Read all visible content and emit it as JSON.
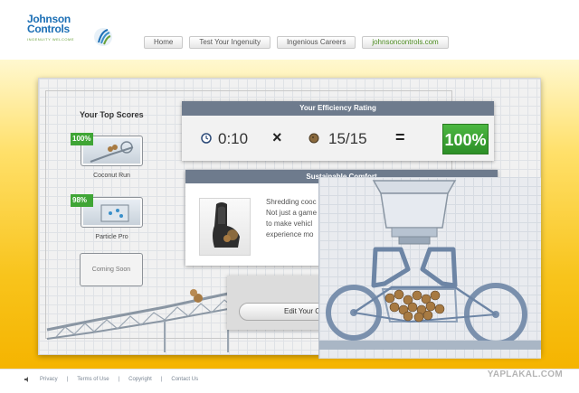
{
  "brand": {
    "name_line1": "Johnson",
    "name_line2": "Controls",
    "tagline": "INGENUITY WELCOME"
  },
  "nav": [
    {
      "label": "Home"
    },
    {
      "label": "Test Your Ingenuity"
    },
    {
      "label": "Ingenious Careers"
    },
    {
      "label": "johnsoncontrols.com"
    }
  ],
  "scores": {
    "title": "Your Top Scores",
    "games": [
      {
        "name": "Coconut Run",
        "score": "100%"
      },
      {
        "name": "Particle Pro",
        "score": "98%"
      }
    ],
    "coming_soon": "Coming Soon"
  },
  "efficiency": {
    "title": "Your Efficiency Rating",
    "time": "0:10",
    "times_symbol": "×",
    "collected": "15/15",
    "equals_symbol": "=",
    "result": "100%",
    "icons": [
      "clock-icon",
      "coconut-icon"
    ]
  },
  "comfort": {
    "title": "Sustainable Comfort",
    "text_lines": [
      "Shredding cooc",
      "Not just a game",
      "to make vehicl",
      "experience mo"
    ]
  },
  "edit_button": "Edit Your C",
  "footer": {
    "links": [
      "Privacy",
      "Terms of Use",
      "Copyright",
      "Contact Us"
    ],
    "icons": [
      "speaker-icon"
    ]
  },
  "watermark": "YAPLAKAL.COM",
  "colors": {
    "accent_green": "#3fa535",
    "brand_blue": "#1c6fb5",
    "panel_header": "#6e7b8d",
    "background_yellow": "#f8c41c"
  }
}
